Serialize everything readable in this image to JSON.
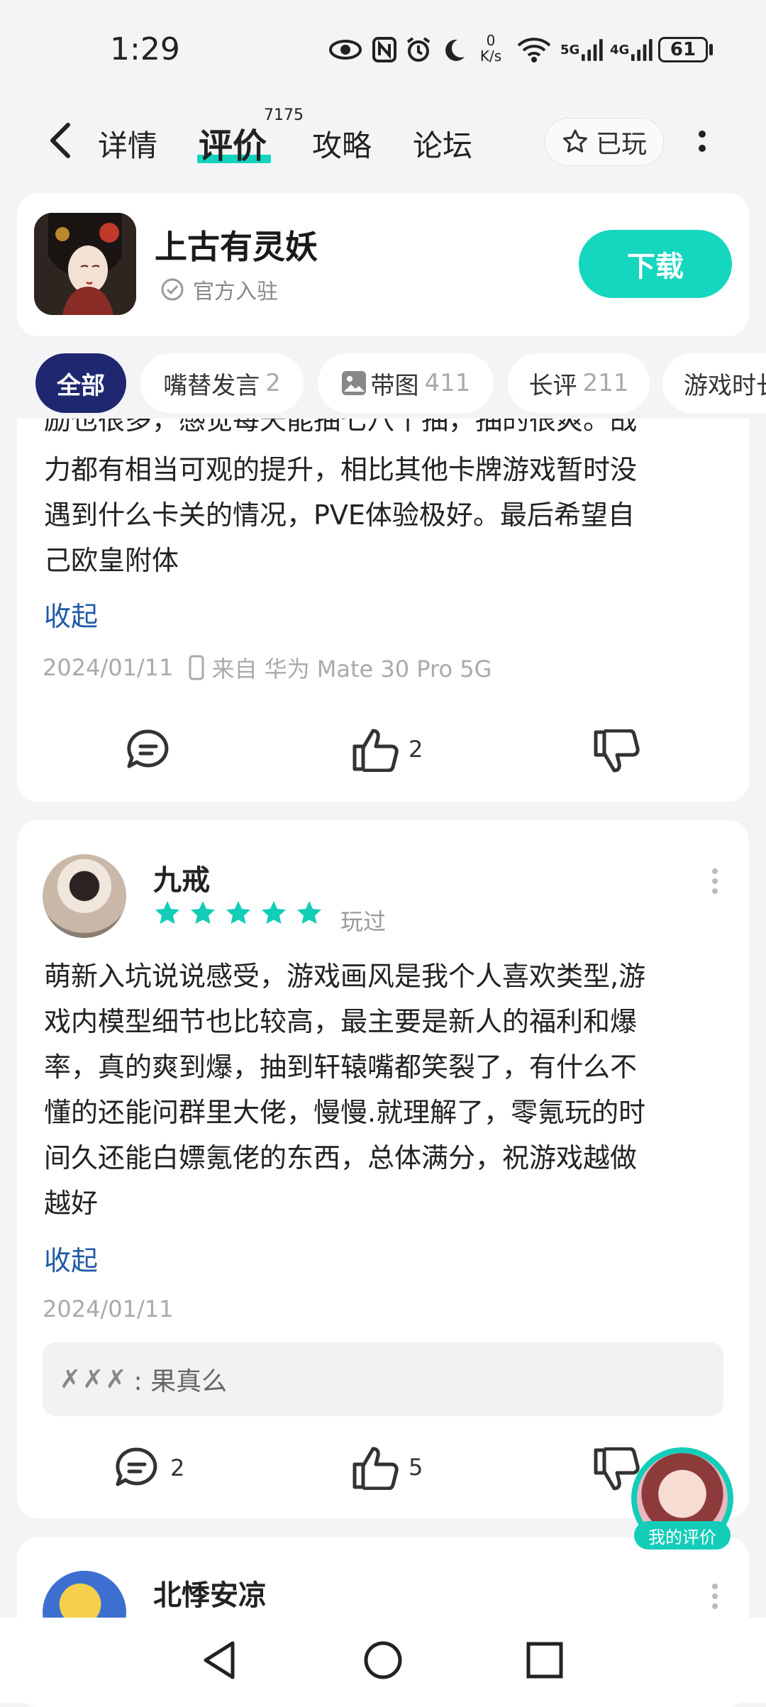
{
  "status_bar": {
    "time": "1:29",
    "net_speed_top": "0",
    "net_speed_unit": "K/s",
    "sig1_label": "5G",
    "sig2_label": "4G",
    "battery": "61"
  },
  "nav": {
    "tabs": [
      "详情",
      "评价",
      "攻略",
      "论坛"
    ],
    "review_count": "7175",
    "played_label": "已玩"
  },
  "app": {
    "title": "上古有灵妖",
    "official": "官方入驻",
    "download": "下载"
  },
  "filters": [
    {
      "label": "全部",
      "count": ""
    },
    {
      "label": "嘴替发言",
      "count": "2"
    },
    {
      "label": "带图",
      "count": "411"
    },
    {
      "label": "长评",
      "count": "211"
    },
    {
      "label": "游戏时长",
      "count": ""
    }
  ],
  "review1": {
    "partial_line": "励也很多，感觉每天能抽七八十抽，抽的很爽。战",
    "lines": [
      "力都有相当可观的提升，相比其他卡牌游戏暂时没",
      "遇到什么卡关的情况，PVE体验极好。最后希望自",
      "己欧皇附体"
    ],
    "collapse": "收起",
    "date": "2024/01/11",
    "device": "来自 华为 Mate 30 Pro 5G",
    "likes": "2"
  },
  "review2": {
    "author": "九戒",
    "rating": 5,
    "played": "玩过",
    "lines": [
      "萌新入坑说说感受，游戏画风是我个人喜欢类型,游",
      "戏内模型细节也比较高，最主要是新人的福利和爆",
      "率，真的爽到爆，抽到轩辕嘴都笑裂了，有什么不",
      "懂的还能问群里大佬，慢慢.就理解了，零氪玩的时",
      "间久还能白嫖氪佬的东西，总体满分，祝游戏越做",
      "越好"
    ],
    "collapse": "收起",
    "date": "2024/01/11",
    "reply_user": "✗✗✗",
    "reply_text": ": 果真么",
    "comments": "2",
    "likes": "5"
  },
  "review3": {
    "author": "北悸安凉"
  },
  "floating": {
    "my_review": "我的评价"
  },
  "colors": {
    "accent": "#15d6bf",
    "chip_active": "#1f2770",
    "link": "#1f5aa6",
    "star": "#13cdb8"
  }
}
